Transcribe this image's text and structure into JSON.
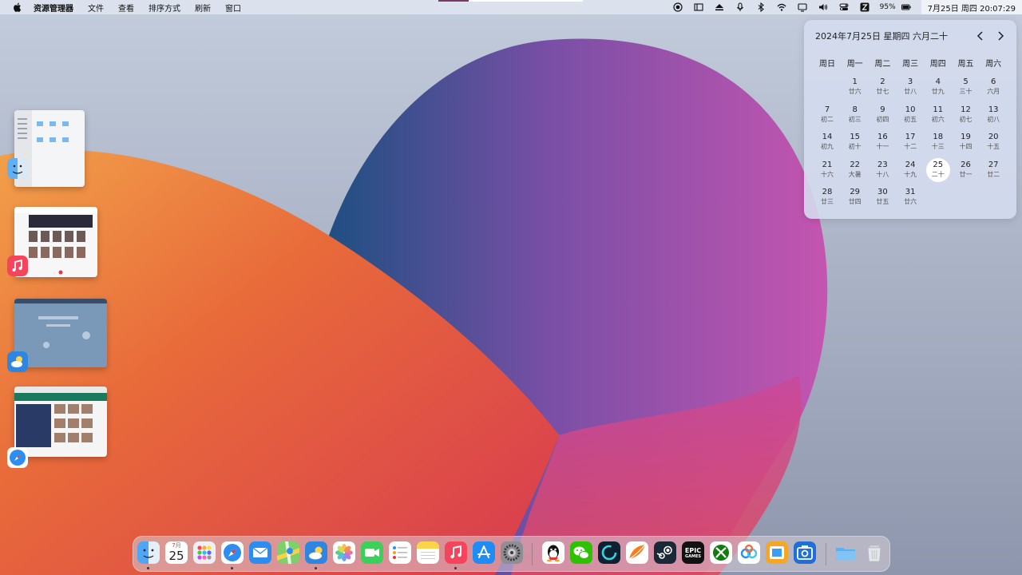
{
  "menubar": {
    "app_name": "资源管理器",
    "menus": [
      "文件",
      "查看",
      "排序方式",
      "刷新",
      "窗口"
    ],
    "battery": "95%",
    "clock": "7月25日 周四 20:07:29",
    "status_icons": [
      "record-icon",
      "sidebar-panel-icon",
      "eject-icon",
      "microphone-icon",
      "bluetooth-icon",
      "wifi-icon",
      "display-icon",
      "volume-icon",
      "control-center-icon",
      "input-method-icon"
    ]
  },
  "calendar": {
    "header": "2024年7月25日 星期四 六月二十",
    "weekdays": [
      "周日",
      "周一",
      "周二",
      "周三",
      "周四",
      "周五",
      "周六"
    ],
    "start_offset": 1,
    "today": 25,
    "days": [
      {
        "n": "1",
        "l": "廿六"
      },
      {
        "n": "2",
        "l": "廿七"
      },
      {
        "n": "3",
        "l": "廿八"
      },
      {
        "n": "4",
        "l": "廿九"
      },
      {
        "n": "5",
        "l": "三十"
      },
      {
        "n": "6",
        "l": "六月"
      },
      {
        "n": "7",
        "l": "初二"
      },
      {
        "n": "8",
        "l": "初三"
      },
      {
        "n": "9",
        "l": "初四"
      },
      {
        "n": "10",
        "l": "初五"
      },
      {
        "n": "11",
        "l": "初六"
      },
      {
        "n": "12",
        "l": "初七"
      },
      {
        "n": "13",
        "l": "初八"
      },
      {
        "n": "14",
        "l": "初九"
      },
      {
        "n": "15",
        "l": "初十"
      },
      {
        "n": "16",
        "l": "十一"
      },
      {
        "n": "17",
        "l": "十二"
      },
      {
        "n": "18",
        "l": "十三"
      },
      {
        "n": "19",
        "l": "十四"
      },
      {
        "n": "20",
        "l": "十五"
      },
      {
        "n": "21",
        "l": "十六"
      },
      {
        "n": "22",
        "l": "大暑"
      },
      {
        "n": "23",
        "l": "十八"
      },
      {
        "n": "24",
        "l": "十九"
      },
      {
        "n": "25",
        "l": "二十"
      },
      {
        "n": "26",
        "l": "廿一"
      },
      {
        "n": "27",
        "l": "廿二"
      },
      {
        "n": "28",
        "l": "廿三"
      },
      {
        "n": "29",
        "l": "廿四"
      },
      {
        "n": "30",
        "l": "廿五"
      },
      {
        "n": "31",
        "l": "廿六"
      }
    ]
  },
  "window_thumbnails": [
    {
      "app": "finder-icon"
    },
    {
      "app": "music-icon"
    },
    {
      "app": "weather-icon"
    },
    {
      "app": "safari-icon"
    }
  ],
  "dock": {
    "calendar_icon": {
      "month": "7月",
      "day": "25"
    },
    "epic_icon": {
      "line1": "EPIC",
      "line2": "GAMES"
    },
    "apps": [
      "finder-icon",
      "calendar-icon",
      "launchpad-icon",
      "safari-icon",
      "mail-icon",
      "maps-icon",
      "weather-icon",
      "photos-icon",
      "facetime-icon",
      "reminders-icon",
      "notes-icon",
      "music-icon",
      "app-store-icon",
      "settings-icon",
      "qq-icon",
      "wechat-icon",
      "ring-app-icon",
      "orange-app-icon",
      "steam-icon",
      "epic-games-icon",
      "xbox-icon",
      "baidu-netdisk-icon",
      "window-app-icon",
      "camera-app-icon",
      "downloads-folder-icon",
      "trash-icon"
    ],
    "colors": {
      "accent_blue": "#1f7ae0",
      "music_red": "#f5455c",
      "wechat_green": "#2dc100",
      "xbox_green": "#107c10"
    }
  }
}
